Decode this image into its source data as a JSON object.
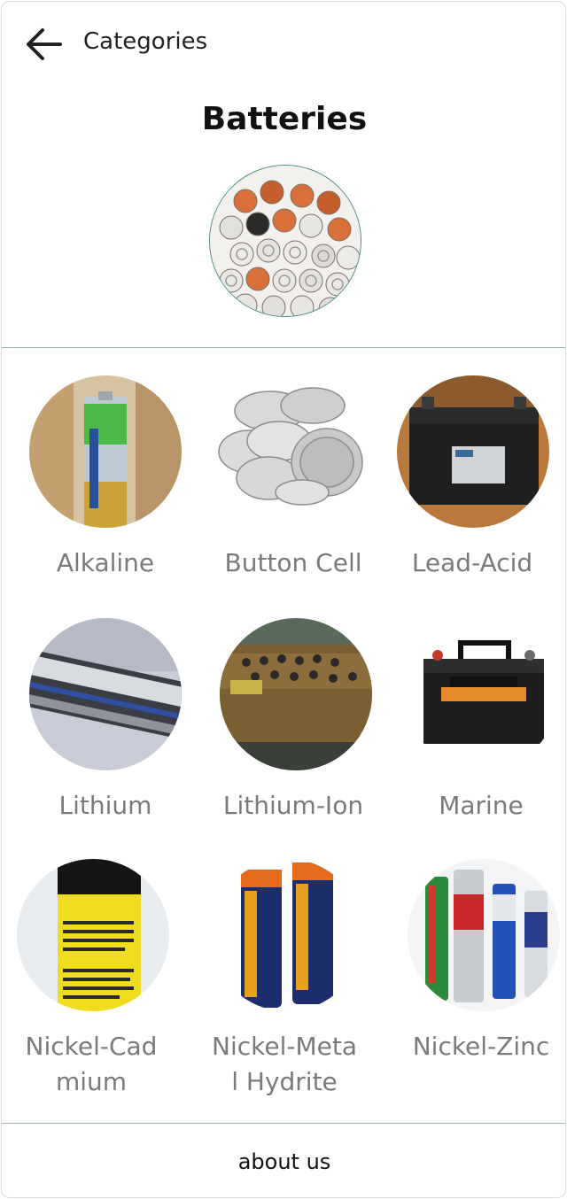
{
  "header": {
    "back_label": "Categories",
    "title": "Batteries"
  },
  "categories": [
    {
      "label": "Alkaline",
      "icon": "alkaline-battery-icon"
    },
    {
      "label": "Button Cell",
      "icon": "button-cell-icon"
    },
    {
      "label": "Lead-Acid",
      "icon": "lead-acid-battery-icon"
    },
    {
      "label": "Lithium",
      "icon": "lithium-battery-icon"
    },
    {
      "label": "Lithium-Ion",
      "icon": "lithium-ion-battery-icon"
    },
    {
      "label": "Marine",
      "icon": "marine-battery-icon"
    },
    {
      "label": "Nickel-Cad\nmium",
      "icon": "nickel-cadmium-battery-icon"
    },
    {
      "label": "Nickel-Meta\nl Hydrite",
      "icon": "nickel-metal-hydride-battery-icon"
    },
    {
      "label": "Nickel-Zinc",
      "icon": "nickel-zinc-battery-icon"
    }
  ],
  "footer": {
    "about_label": "about us"
  },
  "colors": {
    "accent_border": "#4a8a80",
    "label_gray": "#7a7a7a"
  }
}
